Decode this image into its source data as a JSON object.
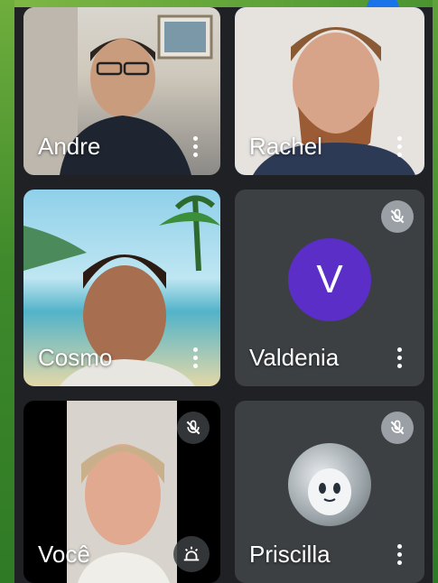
{
  "participants": [
    {
      "name": "Andre",
      "muted": false,
      "speaking": false,
      "kind": "video"
    },
    {
      "name": "Rachel",
      "muted": false,
      "speaking": true,
      "kind": "video"
    },
    {
      "name": "Cosmo",
      "muted": false,
      "speaking": false,
      "kind": "video"
    },
    {
      "name": "Valdenia",
      "muted": true,
      "speaking": false,
      "kind": "avatar",
      "avatar_letter": "V",
      "avatar_color": "#5b2ec7"
    },
    {
      "name": "Você",
      "muted": true,
      "speaking": false,
      "kind": "self-video"
    },
    {
      "name": "Priscilla",
      "muted": true,
      "speaking": false,
      "kind": "avatar-photo"
    }
  ],
  "colors": {
    "tile_bg": "#3c4043",
    "speaking_border": "#1a73e8",
    "background_edge": "#3f8a2b"
  },
  "icons": {
    "more": "more-vert-icon",
    "mute": "mic-off-icon",
    "effects": "visual-effects-icon"
  }
}
